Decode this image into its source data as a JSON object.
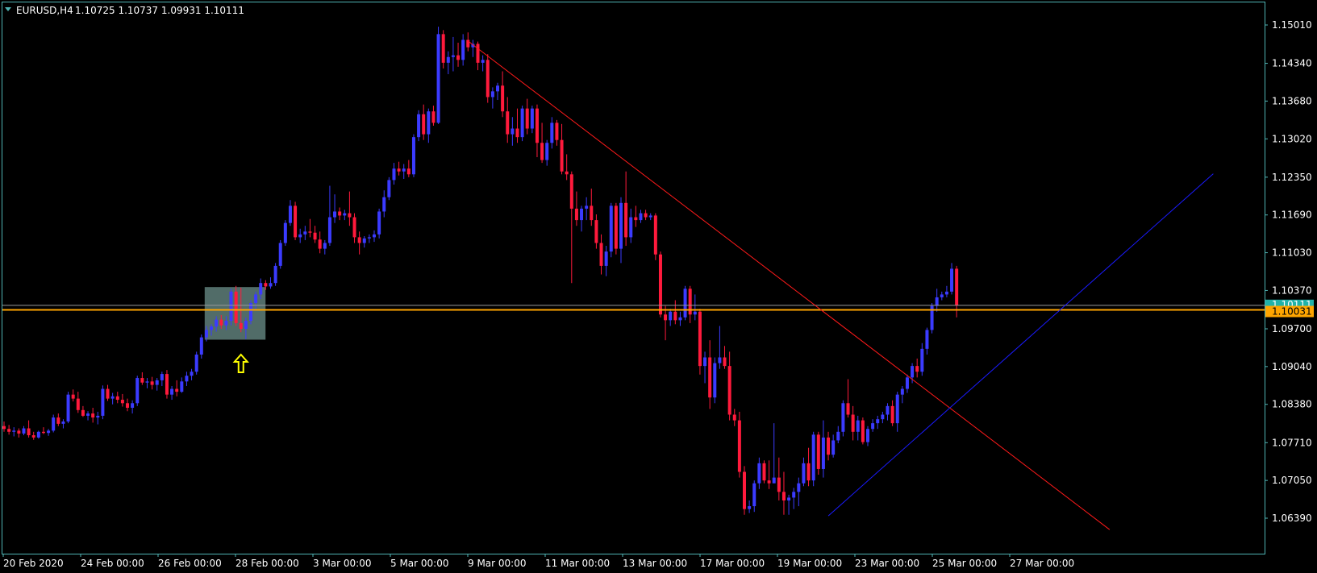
{
  "header": {
    "symbol": "EURUSD,H4",
    "ohlc": "1.10725 1.10737 1.09931 1.10111"
  },
  "colors": {
    "background": "#000000",
    "frame": "#4fb3b3",
    "bull": "#3b3bff",
    "bear": "#ff1a3c",
    "downtrend": "#ff1a1a",
    "uptrend": "#1a1aff",
    "hline": "#ffa500",
    "bid_line": "#9a9a9a",
    "box": "#5f7f7a",
    "arrow": "#ffff00",
    "bid_tag": "#20b2aa",
    "ask_tag": "#ffa500"
  },
  "chart_data": {
    "type": "candlestick",
    "symbol": "EURUSD",
    "timeframe": "H4",
    "ylim": [
      1.0618,
      1.1527
    ],
    "yticks": [
      "1.15010",
      "1.14340",
      "1.13680",
      "1.13020",
      "1.12350",
      "1.11690",
      "1.11030",
      "1.10370",
      "1.09700",
      "1.09040",
      "1.08380",
      "1.07710",
      "1.07050",
      "1.06390"
    ],
    "xticks": [
      {
        "label": "20 Feb 2020",
        "bar": 0
      },
      {
        "label": "24 Feb 00:00",
        "bar": 15
      },
      {
        "label": "26 Feb 00:00",
        "bar": 30
      },
      {
        "label": "28 Feb 00:00",
        "bar": 45
      },
      {
        "label": "3 Mar 00:00",
        "bar": 60
      },
      {
        "label": "5 Mar 00:00",
        "bar": 75
      },
      {
        "label": "9 Mar 00:00",
        "bar": 90
      },
      {
        "label": "11 Mar 00:00",
        "bar": 105
      },
      {
        "label": "13 Mar 00:00",
        "bar": 120
      },
      {
        "label": "17 Mar 00:00",
        "bar": 135
      },
      {
        "label": "19 Mar 00:00",
        "bar": 150
      },
      {
        "label": "23 Mar 00:00",
        "bar": 165
      },
      {
        "label": "25 Mar 00:00",
        "bar": 180
      },
      {
        "label": "27 Mar 00:00",
        "bar": 195
      }
    ],
    "total_slots": 245,
    "ohlc": [
      [
        1.08,
        1.0808,
        1.079,
        1.0795
      ],
      [
        1.0795,
        1.0802,
        1.0785,
        1.079
      ],
      [
        1.079,
        1.0798,
        1.0782,
        1.0792
      ],
      [
        1.0792,
        1.0796,
        1.078,
        1.0787
      ],
      [
        1.0787,
        1.08,
        1.0784,
        1.0796
      ],
      [
        1.0796,
        1.081,
        1.078,
        1.0784
      ],
      [
        1.0784,
        1.079,
        1.0776,
        1.078
      ],
      [
        1.078,
        1.0792,
        1.0778,
        1.079
      ],
      [
        1.079,
        1.0798,
        1.0786,
        1.0788
      ],
      [
        1.0788,
        1.0795,
        1.0783,
        1.0792
      ],
      [
        1.0792,
        1.082,
        1.0789,
        1.0815
      ],
      [
        1.0815,
        1.0822,
        1.08,
        1.0804
      ],
      [
        1.0804,
        1.0812,
        1.0796,
        1.0808
      ],
      [
        1.0808,
        1.086,
        1.0805,
        1.0855
      ],
      [
        1.0855,
        1.0864,
        1.0843,
        1.0848
      ],
      [
        1.0848,
        1.086,
        1.0823,
        1.0828
      ],
      [
        1.0828,
        1.0835,
        1.0816,
        1.0818
      ],
      [
        1.0818,
        1.0826,
        1.081,
        1.0822
      ],
      [
        1.0822,
        1.0832,
        1.0806,
        1.0815
      ],
      [
        1.0815,
        1.0825,
        1.0803,
        1.0818
      ],
      [
        1.0818,
        1.0871,
        1.0812,
        1.0865
      ],
      [
        1.0865,
        1.0872,
        1.0844,
        1.0848
      ],
      [
        1.0848,
        1.0858,
        1.0838,
        1.0852
      ],
      [
        1.0852,
        1.086,
        1.084,
        1.0846
      ],
      [
        1.0846,
        1.0856,
        1.0834,
        1.084
      ],
      [
        1.084,
        1.0848,
        1.0826,
        1.0832
      ],
      [
        1.0832,
        1.0845,
        1.0822,
        1.084
      ],
      [
        1.084,
        1.0888,
        1.0835,
        1.0884
      ],
      [
        1.0884,
        1.0894,
        1.0872,
        1.0876
      ],
      [
        1.0876,
        1.0884,
        1.0866,
        1.0878
      ],
      [
        1.0878,
        1.0886,
        1.0864,
        1.0872
      ],
      [
        1.0872,
        1.0884,
        1.0862,
        1.088
      ],
      [
        1.088,
        1.0895,
        1.087,
        1.0891
      ],
      [
        1.0891,
        1.0898,
        1.0848,
        1.0855
      ],
      [
        1.0855,
        1.087,
        1.0846,
        1.0865
      ],
      [
        1.0865,
        1.088,
        1.0852,
        1.086
      ],
      [
        1.086,
        1.0885,
        1.0858,
        1.0878
      ],
      [
        1.0878,
        1.0895,
        1.087,
        1.0888
      ],
      [
        1.0888,
        1.09,
        1.088,
        1.0895
      ],
      [
        1.0895,
        1.093,
        1.089,
        1.0925
      ],
      [
        1.0925,
        1.096,
        1.0918,
        1.0955
      ],
      [
        1.0955,
        1.0975,
        1.0948,
        1.0968
      ],
      [
        1.0968,
        1.0978,
        1.0958,
        1.0974
      ],
      [
        1.0974,
        1.0992,
        1.0965,
        1.0986
      ],
      [
        1.0986,
        1.0994,
        1.097,
        1.0976
      ],
      [
        1.0976,
        1.0992,
        1.0968,
        1.0984
      ],
      [
        1.0984,
        1.104,
        1.0976,
        1.1035
      ],
      [
        1.1035,
        1.1045,
        1.0975,
        1.098
      ],
      [
        1.098,
        1.1042,
        1.0964,
        1.097
      ],
      [
        1.097,
        1.099,
        1.0952,
        1.0984
      ],
      [
        1.0984,
        1.102,
        1.0978,
        1.1015
      ],
      [
        1.1015,
        1.1035,
        1.1005,
        1.103
      ],
      [
        1.103,
        1.1058,
        1.1022,
        1.105
      ],
      [
        1.105,
        1.1055,
        1.1038,
        1.1044
      ],
      [
        1.1044,
        1.106,
        1.104,
        1.105
      ],
      [
        1.105,
        1.1085,
        1.1045,
        1.108
      ],
      [
        1.108,
        1.1125,
        1.1075,
        1.112
      ],
      [
        1.112,
        1.116,
        1.1115,
        1.1155
      ],
      [
        1.1155,
        1.1195,
        1.115,
        1.1185
      ],
      [
        1.1185,
        1.1192,
        1.1125,
        1.113
      ],
      [
        1.113,
        1.1145,
        1.112,
        1.1135
      ],
      [
        1.1135,
        1.115,
        1.1125,
        1.114
      ],
      [
        1.114,
        1.1162,
        1.113,
        1.1138
      ],
      [
        1.1138,
        1.115,
        1.112,
        1.1126
      ],
      [
        1.1126,
        1.114,
        1.1102,
        1.111
      ],
      [
        1.111,
        1.1125,
        1.11,
        1.112
      ],
      [
        1.112,
        1.122,
        1.1115,
        1.1165
      ],
      [
        1.1165,
        1.1205,
        1.1155,
        1.1175
      ],
      [
        1.1175,
        1.1182,
        1.116,
        1.1168
      ],
      [
        1.1168,
        1.1178,
        1.116,
        1.1172
      ],
      [
        1.1172,
        1.121,
        1.115,
        1.1165
      ],
      [
        1.1165,
        1.1172,
        1.112,
        1.113
      ],
      [
        1.113,
        1.114,
        1.11,
        1.112
      ],
      [
        1.112,
        1.1132,
        1.1112,
        1.1128
      ],
      [
        1.1128,
        1.1135,
        1.112,
        1.113
      ],
      [
        1.113,
        1.1142,
        1.1122,
        1.1135
      ],
      [
        1.1135,
        1.118,
        1.1128,
        1.1175
      ],
      [
        1.1175,
        1.1212,
        1.1165,
        1.12
      ],
      [
        1.12,
        1.1235,
        1.1195,
        1.123
      ],
      [
        1.123,
        1.126,
        1.1222,
        1.125
      ],
      [
        1.125,
        1.1262,
        1.1238,
        1.1245
      ],
      [
        1.1245,
        1.1258,
        1.1232,
        1.125
      ],
      [
        1.125,
        1.1265,
        1.1235,
        1.124
      ],
      [
        1.124,
        1.131,
        1.1235,
        1.1305
      ],
      [
        1.1305,
        1.1352,
        1.1298,
        1.1345
      ],
      [
        1.1345,
        1.1362,
        1.13,
        1.131
      ],
      [
        1.131,
        1.1355,
        1.1295,
        1.135
      ],
      [
        1.135,
        1.136,
        1.1325,
        1.133
      ],
      [
        1.133,
        1.1498,
        1.1328,
        1.1485
      ],
      [
        1.1485,
        1.1492,
        1.1425,
        1.1435
      ],
      [
        1.1435,
        1.1455,
        1.1415,
        1.1445
      ],
      [
        1.1445,
        1.148,
        1.142,
        1.1448
      ],
      [
        1.1448,
        1.147,
        1.1428,
        1.144
      ],
      [
        1.144,
        1.1485,
        1.143,
        1.1475
      ],
      [
        1.1475,
        1.1488,
        1.1455,
        1.1462
      ],
      [
        1.1462,
        1.1475,
        1.1445,
        1.1468
      ],
      [
        1.1468,
        1.1472,
        1.1422,
        1.1435
      ],
      [
        1.1435,
        1.1448,
        1.142,
        1.144
      ],
      [
        1.144,
        1.145,
        1.1365,
        1.1375
      ],
      [
        1.1375,
        1.1392,
        1.1355,
        1.1385
      ],
      [
        1.1385,
        1.14,
        1.137,
        1.1395
      ],
      [
        1.1395,
        1.142,
        1.134,
        1.135
      ],
      [
        1.135,
        1.1375,
        1.1295,
        1.131
      ],
      [
        1.131,
        1.134,
        1.129,
        1.132
      ],
      [
        1.132,
        1.1355,
        1.1295,
        1.1305
      ],
      [
        1.1305,
        1.136,
        1.1298,
        1.1355
      ],
      [
        1.1355,
        1.1372,
        1.131,
        1.132
      ],
      [
        1.132,
        1.136,
        1.1312,
        1.1355
      ],
      [
        1.1355,
        1.1362,
        1.127,
        1.1295
      ],
      [
        1.1295,
        1.133,
        1.126,
        1.1265
      ],
      [
        1.1265,
        1.13,
        1.1255,
        1.1295
      ],
      [
        1.1295,
        1.134,
        1.1285,
        1.133
      ],
      [
        1.133,
        1.1335,
        1.129,
        1.13
      ],
      [
        1.13,
        1.1328,
        1.124,
        1.1245
      ],
      [
        1.1245,
        1.1275,
        1.123,
        1.124
      ],
      [
        1.124,
        1.1245,
        1.105,
        1.118
      ],
      [
        1.118,
        1.121,
        1.115,
        1.116
      ],
      [
        1.116,
        1.1185,
        1.114,
        1.118
      ],
      [
        1.118,
        1.12,
        1.116,
        1.1185
      ],
      [
        1.1185,
        1.1215,
        1.115,
        1.116
      ],
      [
        1.116,
        1.117,
        1.111,
        1.112
      ],
      [
        1.112,
        1.1135,
        1.1065,
        1.108
      ],
      [
        1.108,
        1.1115,
        1.1062,
        1.1105
      ],
      [
        1.1105,
        1.119,
        1.1095,
        1.1185
      ],
      [
        1.1185,
        1.119,
        1.11,
        1.111
      ],
      [
        1.111,
        1.12,
        1.1085,
        1.119
      ],
      [
        1.119,
        1.1245,
        1.1115,
        1.113
      ],
      [
        1.113,
        1.118,
        1.112,
        1.1165
      ],
      [
        1.1165,
        1.1185,
        1.1148,
        1.116
      ],
      [
        1.116,
        1.1178,
        1.1155,
        1.1172
      ],
      [
        1.1172,
        1.1178,
        1.116,
        1.1165
      ],
      [
        1.1165,
        1.1172,
        1.116,
        1.1168
      ],
      [
        1.1168,
        1.1172,
        1.109,
        1.11
      ],
      [
        1.11,
        1.1105,
        1.099,
        1.0995
      ],
      [
        1.0995,
        1.101,
        1.095,
        1.0985
      ],
      [
        1.0985,
        1.1005,
        1.0975,
        1.1
      ],
      [
        1.1,
        1.102,
        1.0978,
        1.0985
      ],
      [
        1.0985,
        1.1,
        1.0975,
        1.099
      ],
      [
        1.099,
        1.1045,
        1.0985,
        1.104
      ],
      [
        1.104,
        1.1045,
        1.098,
        1.0995
      ],
      [
        1.0995,
        1.103,
        1.0985,
        1.1
      ],
      [
        1.1,
        1.1005,
        1.089,
        1.0905
      ],
      [
        1.0905,
        1.093,
        1.0875,
        1.092
      ],
      [
        1.092,
        1.095,
        1.083,
        1.085
      ],
      [
        1.085,
        1.092,
        1.084,
        1.091
      ],
      [
        1.091,
        1.0975,
        1.09,
        1.092
      ],
      [
        1.092,
        1.094,
        1.09,
        1.0905
      ],
      [
        1.0905,
        1.093,
        1.081,
        1.082
      ],
      [
        1.082,
        1.083,
        1.08,
        1.081
      ],
      [
        1.081,
        1.0825,
        1.071,
        1.072
      ],
      [
        1.072,
        1.073,
        1.0645,
        1.0655
      ],
      [
        1.0655,
        1.067,
        1.0648,
        1.066
      ],
      [
        1.066,
        1.0705,
        1.065,
        1.07
      ],
      [
        1.07,
        1.0745,
        1.069,
        1.0735
      ],
      [
        1.0735,
        1.074,
        1.07,
        1.0705
      ],
      [
        1.0705,
        1.074,
        1.069,
        1.07
      ],
      [
        1.07,
        1.0805,
        1.07,
        1.071
      ],
      [
        1.071,
        1.0745,
        1.067,
        1.0685
      ],
      [
        1.0685,
        1.072,
        1.0645,
        1.067
      ],
      [
        1.067,
        1.068,
        1.0645,
        1.0675
      ],
      [
        1.0675,
        1.0692,
        1.0655,
        1.0685
      ],
      [
        1.0685,
        1.071,
        1.066,
        1.07
      ],
      [
        1.07,
        1.0745,
        1.0695,
        1.0735
      ],
      [
        1.0735,
        1.0762,
        1.0695,
        1.0705
      ],
      [
        1.0705,
        1.079,
        1.0695,
        1.0785
      ],
      [
        1.0785,
        1.079,
        1.0715,
        1.0725
      ],
      [
        1.0725,
        1.081,
        1.071,
        1.078
      ],
      [
        1.078,
        1.079,
        1.074,
        1.075
      ],
      [
        1.075,
        1.0785,
        1.0745,
        1.0775
      ],
      [
        1.0775,
        1.08,
        1.077,
        1.079
      ],
      [
        1.079,
        1.0845,
        1.0782,
        1.084
      ],
      [
        1.084,
        1.0882,
        1.0815,
        1.082
      ],
      [
        1.082,
        1.0835,
        1.0775,
        1.079
      ],
      [
        1.079,
        1.0818,
        1.0775,
        1.081
      ],
      [
        1.081,
        1.0815,
        1.0768,
        1.0772
      ],
      [
        1.0772,
        1.08,
        1.0765,
        1.0795
      ],
      [
        1.0795,
        1.0812,
        1.079,
        1.0805
      ],
      [
        1.0805,
        1.0818,
        1.0795,
        1.0812
      ],
      [
        1.0812,
        1.0825,
        1.0805,
        1.082
      ],
      [
        1.082,
        1.084,
        1.081,
        1.0835
      ],
      [
        1.0835,
        1.0845,
        1.08,
        1.0805
      ],
      [
        1.0805,
        1.086,
        1.079,
        1.0855
      ],
      [
        1.0855,
        1.087,
        1.084,
        1.0865
      ],
      [
        1.0865,
        1.089,
        1.0858,
        1.0885
      ],
      [
        1.0885,
        1.091,
        1.0875,
        1.0905
      ],
      [
        1.0905,
        1.0918,
        1.0885,
        1.0895
      ],
      [
        1.0895,
        1.0945,
        1.0888,
        1.0935
      ],
      [
        1.0935,
        1.0972,
        1.0925,
        1.0968
      ],
      [
        1.0968,
        1.1015,
        1.0962,
        1.101
      ],
      [
        1.101,
        1.104,
        1.1,
        1.1025
      ],
      [
        1.1025,
        1.1035,
        1.102,
        1.103
      ],
      [
        1.103,
        1.1045,
        1.1025,
        1.1035
      ],
      [
        1.1035,
        1.1085,
        1.103,
        1.1075
      ],
      [
        1.1075,
        1.108,
        1.099,
        1.1011
      ]
    ],
    "annotations": {
      "downtrend_line": {
        "from_bar": 94,
        "from_price": 1.1473,
        "to_bar": 224,
        "to_price": 1.0619
      },
      "uptrend_line": {
        "from_bar": 167,
        "from_price": 1.0643,
        "to_bar": 245,
        "to_price": 1.1241
      },
      "horizontal_line_price": 1.10031,
      "bid_line_price": 1.10111,
      "highlight_box": {
        "from_bar": 40,
        "to_bar": 52,
        "price_top": 1.1043,
        "price_bottom": 1.0951
      },
      "arrow": {
        "bar": 48,
        "price": 1.0908
      }
    },
    "price_tags": {
      "bid": "1.10111",
      "level": "1.10031"
    },
    "grid": false,
    "legend": "none"
  }
}
